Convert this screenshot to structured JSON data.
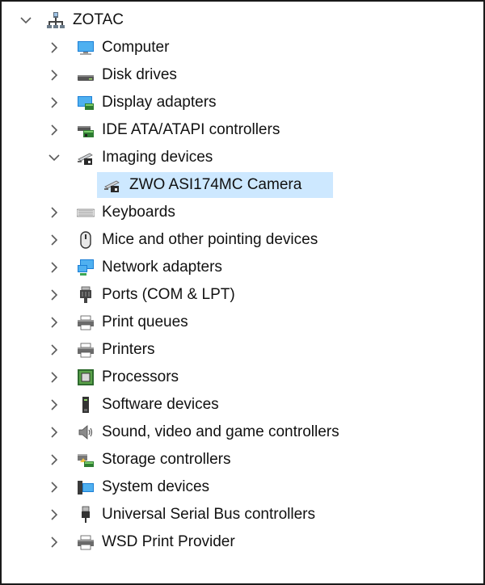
{
  "tree": {
    "root": {
      "label": "ZOTAC",
      "icon": "computer-root-icon",
      "expanded": true
    },
    "categories": [
      {
        "label": "Computer",
        "icon": "monitor-icon",
        "expanded": false
      },
      {
        "label": "Disk drives",
        "icon": "disk-drive-icon",
        "expanded": false
      },
      {
        "label": "Display adapters",
        "icon": "display-adapter-icon",
        "expanded": false
      },
      {
        "label": "IDE ATA/ATAPI controllers",
        "icon": "ide-controller-icon",
        "expanded": false
      },
      {
        "label": "Imaging devices",
        "icon": "camera-icon",
        "expanded": true,
        "children": [
          {
            "label": "ZWO ASI174MC Camera",
            "icon": "camera-icon",
            "selected": true
          }
        ]
      },
      {
        "label": "Keyboards",
        "icon": "keyboard-icon",
        "expanded": false
      },
      {
        "label": "Mice and other pointing devices",
        "icon": "mouse-icon",
        "expanded": false
      },
      {
        "label": "Network adapters",
        "icon": "network-icon",
        "expanded": false
      },
      {
        "label": "Ports (COM & LPT)",
        "icon": "port-icon",
        "expanded": false
      },
      {
        "label": "Print queues",
        "icon": "printer-icon",
        "expanded": false
      },
      {
        "label": "Printers",
        "icon": "printer-icon",
        "expanded": false
      },
      {
        "label": "Processors",
        "icon": "processor-icon",
        "expanded": false
      },
      {
        "label": "Software devices",
        "icon": "software-device-icon",
        "expanded": false
      },
      {
        "label": "Sound, video and game controllers",
        "icon": "speaker-icon",
        "expanded": false
      },
      {
        "label": "Storage controllers",
        "icon": "storage-controller-icon",
        "expanded": false
      },
      {
        "label": "System devices",
        "icon": "system-device-icon",
        "expanded": false
      },
      {
        "label": "Universal Serial Bus controllers",
        "icon": "usb-icon",
        "expanded": false
      },
      {
        "label": "WSD Print Provider",
        "icon": "printer-icon",
        "expanded": false
      }
    ]
  },
  "colors": {
    "selection": "#cde8ff",
    "text": "#111111",
    "chevron": "#5a5a5a"
  }
}
